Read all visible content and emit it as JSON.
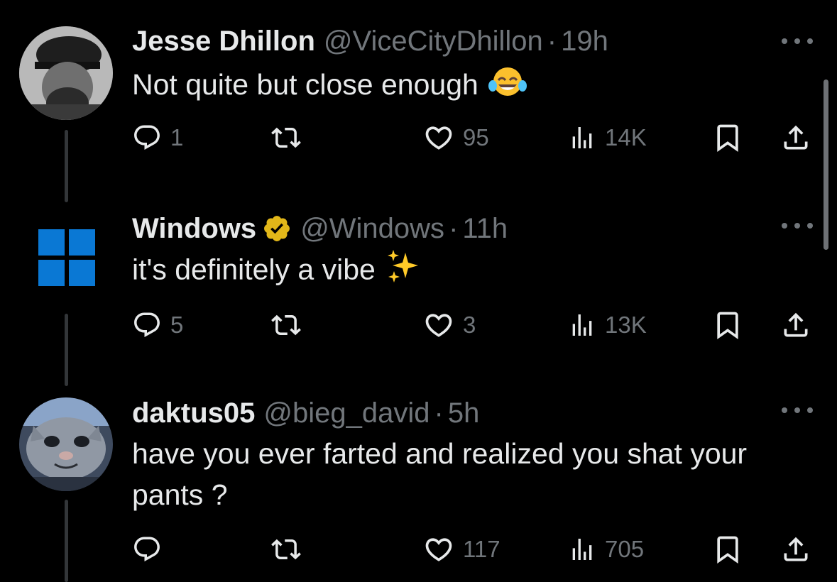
{
  "colors": {
    "background": "#000000",
    "text_primary": "#e7e9ea",
    "text_secondary": "#71767b",
    "verified_gold": "#e2b719",
    "windows_blue": "#0a78d4"
  },
  "tweets": [
    {
      "name": "Jesse Dhillon",
      "handle": "@ViceCityDhillon",
      "separator": "·",
      "time": "19h",
      "text": "Not quite but close enough",
      "emoji": "face-with-tears-of-joy-icon",
      "replies": "1",
      "retweets": "",
      "likes": "95",
      "views": "14K"
    },
    {
      "name": "Windows",
      "verified": "gold-check-badge",
      "handle": "@Windows",
      "separator": "·",
      "time": "11h",
      "text": "it's definitely a vibe",
      "emoji": "sparkles-icon",
      "replies": "5",
      "retweets": "",
      "likes": "3",
      "views": "13K"
    },
    {
      "name": "daktus05",
      "handle": "@bieg_david",
      "separator": "·",
      "time": "5h",
      "text": "have you ever farted and realized you shat your pants ?",
      "replies": "",
      "retweets": "",
      "likes": "117",
      "views": "705"
    }
  ]
}
